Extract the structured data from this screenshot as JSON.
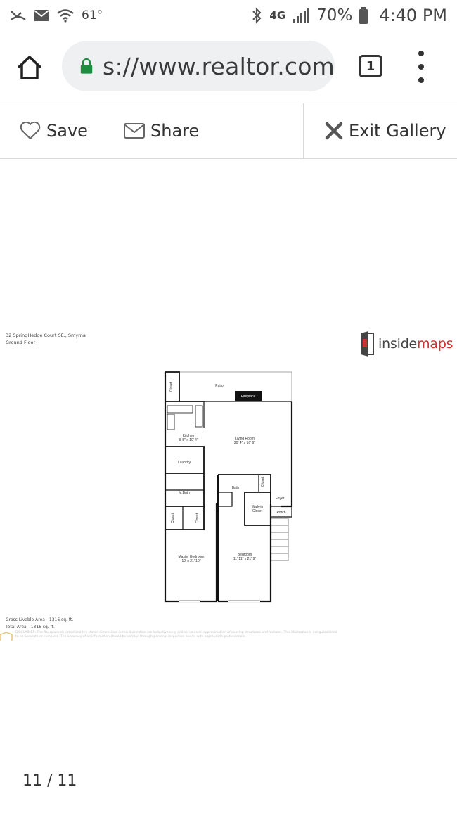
{
  "status": {
    "temperature": "61°",
    "network": "4G",
    "battery": "70%",
    "time": "4:40 PM"
  },
  "browser": {
    "url": "s://www.realtor.com",
    "tab_count": "1"
  },
  "toolbar": {
    "save_label": "Save",
    "share_label": "Share",
    "exit_label": "Exit Gallery"
  },
  "plan": {
    "address": "32 SpringHedge Court SE., Smyrna",
    "floor": "Ground Floor",
    "logo_inside": "inside",
    "logo_maps": "maps",
    "rooms": {
      "closet": "Closet",
      "patio": "Patio",
      "fireplace": "Fireplace",
      "kitchen": "Kitchen",
      "kitchen_dim": "8' 5\" x 10' 4\"",
      "living": "Living Room",
      "living_dim": "20' 4\" x 16' 6\"",
      "laundry": "Laundry",
      "mbath": "M.Bath",
      "bath": "Bath",
      "foyer": "Foyer",
      "walkin": "Walk-in",
      "walkin2": "Closet",
      "porch": "Porch",
      "master": "Master Bedroom",
      "master_dim": "12' x 21' 10\"",
      "bedroom": "Bedroom",
      "bedroom_dim": "11' 11\" x 21' 9\""
    },
    "gross_area": "Gross Livable Area - 1316 sq. ft.",
    "total_area": "Total Area - 1316 sq. ft.",
    "disclaimer": "DISCLAIMER: The floorplans depicted and the stated dimensions in this illustration are indicative only and serve as an approximation of existing structures and features. This illustration is not guaranteed to be accurate or complete. The accuracy of all information should be verified through personal inspection and/or with appropriate professionals."
  },
  "gallery": {
    "counter": "11 / 11"
  },
  "colors": {
    "lock_green": "#1e8e3e",
    "logo_red": "#cc3333"
  }
}
